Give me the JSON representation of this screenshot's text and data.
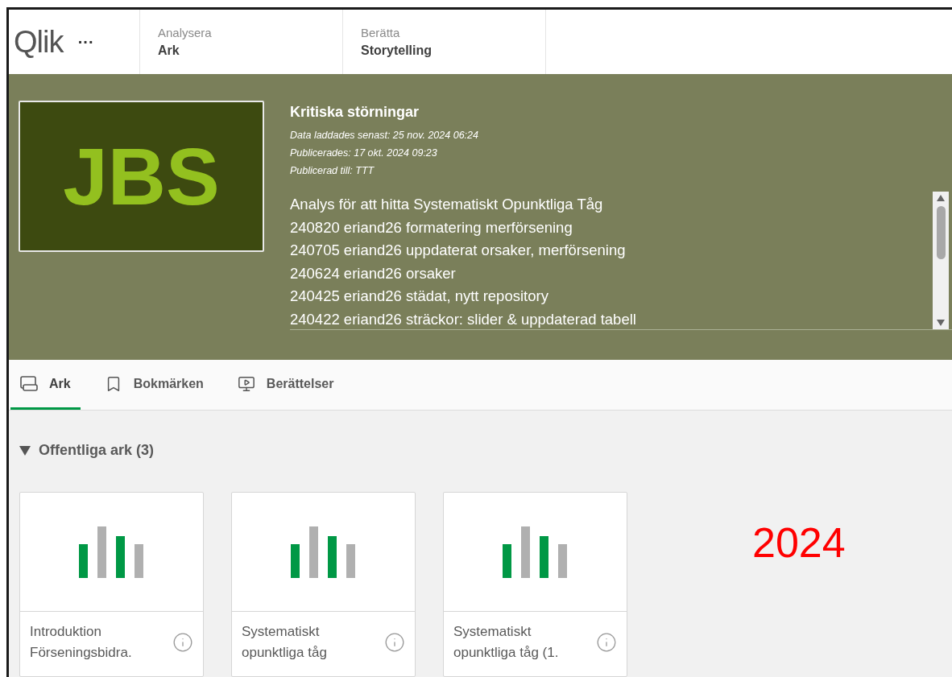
{
  "header": {
    "logo": "Qlik",
    "more": "···",
    "nav": [
      {
        "kicker": "Analysera",
        "label": "Ark"
      },
      {
        "kicker": "Berätta",
        "label": "Storytelling"
      }
    ]
  },
  "app": {
    "thumbnail": "JBS",
    "title": "Kritiska störningar",
    "meta": [
      "Data laddades senast: 25 nov. 2024 06:24",
      "Publicerades: 17 okt. 2024 09:23",
      "Publicerad till: TTT"
    ],
    "description": [
      "Analys för att hitta Systematiskt Opunktliga Tåg",
      "240820 eriand26 formatering merförsening",
      "240705 eriand26 uppdaterat orsaker, merförsening",
      "240624 eriand26 orsaker",
      "240425 eriand26 städat, nytt repository",
      "240422 eriand26 sträckor: slider & uppdaterad tabell"
    ]
  },
  "tabs": [
    {
      "label": "Ark",
      "kind": "sheet",
      "selected": true
    },
    {
      "label": "Bokmärken",
      "kind": "bookmark",
      "selected": false
    },
    {
      "label": "Berättelser",
      "kind": "story",
      "selected": false
    }
  ],
  "section": {
    "title": "Offentliga ark (3)",
    "expanded": true
  },
  "sheets": [
    {
      "lines": [
        "Introduktion",
        "Förseningsbidra."
      ]
    },
    {
      "lines": [
        "Systematiskt",
        "opunktliga tåg"
      ]
    },
    {
      "lines": [
        "Systematiskt",
        "opunktliga tåg (1."
      ]
    }
  ],
  "annotation": "2024"
}
